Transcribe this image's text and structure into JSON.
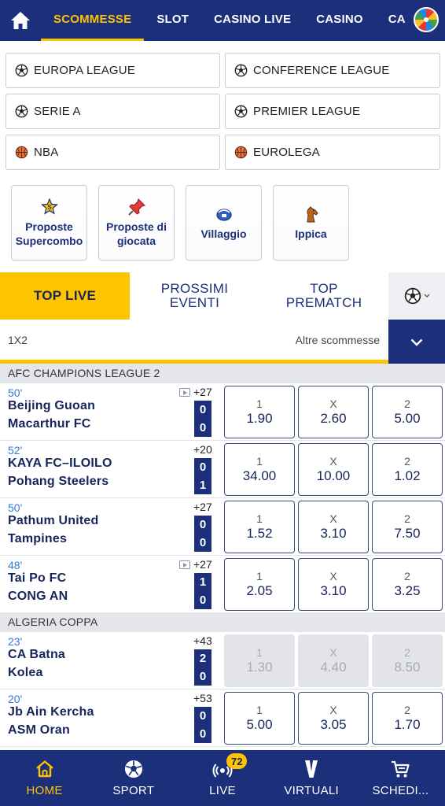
{
  "top_nav": {
    "tabs": [
      {
        "label": "SCOMMESSE",
        "active": true
      },
      {
        "label": "SLOT"
      },
      {
        "label": "CASINO LIVE"
      },
      {
        "label": "CASINO"
      },
      {
        "label": "CA"
      }
    ]
  },
  "leagues": [
    {
      "label": "EUROPA LEAGUE",
      "icon": "soccer-ball-icon"
    },
    {
      "label": "CONFERENCE LEAGUE",
      "icon": "soccer-ball-icon"
    },
    {
      "label": "SERIE A",
      "icon": "soccer-ball-icon"
    },
    {
      "label": "PREMIER LEAGUE",
      "icon": "soccer-ball-icon"
    },
    {
      "label": "NBA",
      "icon": "basketball-icon"
    },
    {
      "label": "EUROLEGA",
      "icon": "basketball-icon"
    }
  ],
  "promos": [
    {
      "line1": "Proposte",
      "line2": "Supercombo",
      "icon": "supercombo-icon"
    },
    {
      "line1": "Proposte di",
      "line2": "giocata",
      "icon": "pin-icon"
    },
    {
      "line1": "Villaggio",
      "line2": "",
      "icon": "villaggio-icon"
    },
    {
      "line1": "Ippica",
      "line2": "",
      "icon": "horse-icon"
    }
  ],
  "section_tabs": {
    "top_live": "TOP LIVE",
    "prossimi_1": "PROSSIMI",
    "prossimi_2": "EVENTI",
    "top_prematch_1": "TOP",
    "top_prematch_2": "PREMATCH"
  },
  "filter": {
    "market": "1X2",
    "more": "Altre scommesse"
  },
  "competitions": [
    {
      "name": "AFC CHAMPIONS LEAGUE 2",
      "matches": [
        {
          "minute": "50'",
          "home": "Beijing Guoan",
          "away": "Macarthur FC",
          "plus": "+27",
          "tv": true,
          "score_home": "0",
          "score_away": "0",
          "odds": [
            "1.90",
            "2.60",
            "5.00"
          ],
          "disabled": false
        },
        {
          "minute": "52'",
          "home": "KAYA FC–ILOILO",
          "away": "Pohang Steelers",
          "plus": "+20",
          "tv": false,
          "score_home": "0",
          "score_away": "1",
          "odds": [
            "34.00",
            "10.00",
            "1.02"
          ],
          "disabled": false
        },
        {
          "minute": "50'",
          "home": "Pathum United",
          "away": "Tampines",
          "plus": "+27",
          "tv": false,
          "score_home": "0",
          "score_away": "0",
          "odds": [
            "1.52",
            "3.10",
            "7.50"
          ],
          "disabled": false
        },
        {
          "minute": "48'",
          "home": "Tai Po FC",
          "away": "CONG AN",
          "plus": "+27",
          "tv": true,
          "score_home": "1",
          "score_away": "0",
          "odds": [
            "2.05",
            "3.10",
            "3.25"
          ],
          "disabled": false
        }
      ]
    },
    {
      "name": "ALGERIA COPPA",
      "matches": [
        {
          "minute": "23'",
          "home": "CA Batna",
          "away": "Kolea",
          "plus": "+43",
          "tv": false,
          "score_home": "2",
          "score_away": "0",
          "odds": [
            "1.30",
            "4.40",
            "8.50"
          ],
          "disabled": true
        },
        {
          "minute": "20'",
          "home": "Jb Ain Kercha",
          "away": "ASM Oran",
          "plus": "+53",
          "tv": false,
          "score_home": "0",
          "score_away": "0",
          "odds": [
            "5.00",
            "3.05",
            "1.70"
          ],
          "disabled": false
        }
      ]
    }
  ],
  "odd_keys": [
    "1",
    "X",
    "2"
  ],
  "bottom_nav": [
    {
      "label": "HOME",
      "icon": "home-icon",
      "active": true
    },
    {
      "label": "SPORT",
      "icon": "soccer-ball-icon"
    },
    {
      "label": "LIVE",
      "icon": "live-icon",
      "badge": "72"
    },
    {
      "label": "VIRTUALI",
      "icon": "virtuali-icon"
    },
    {
      "label": "SCHEDI...",
      "icon": "cart-icon"
    }
  ],
  "colors": {
    "primary": "#1b2f7a",
    "accent": "#ffc400",
    "minute": "#2f7bd6"
  }
}
